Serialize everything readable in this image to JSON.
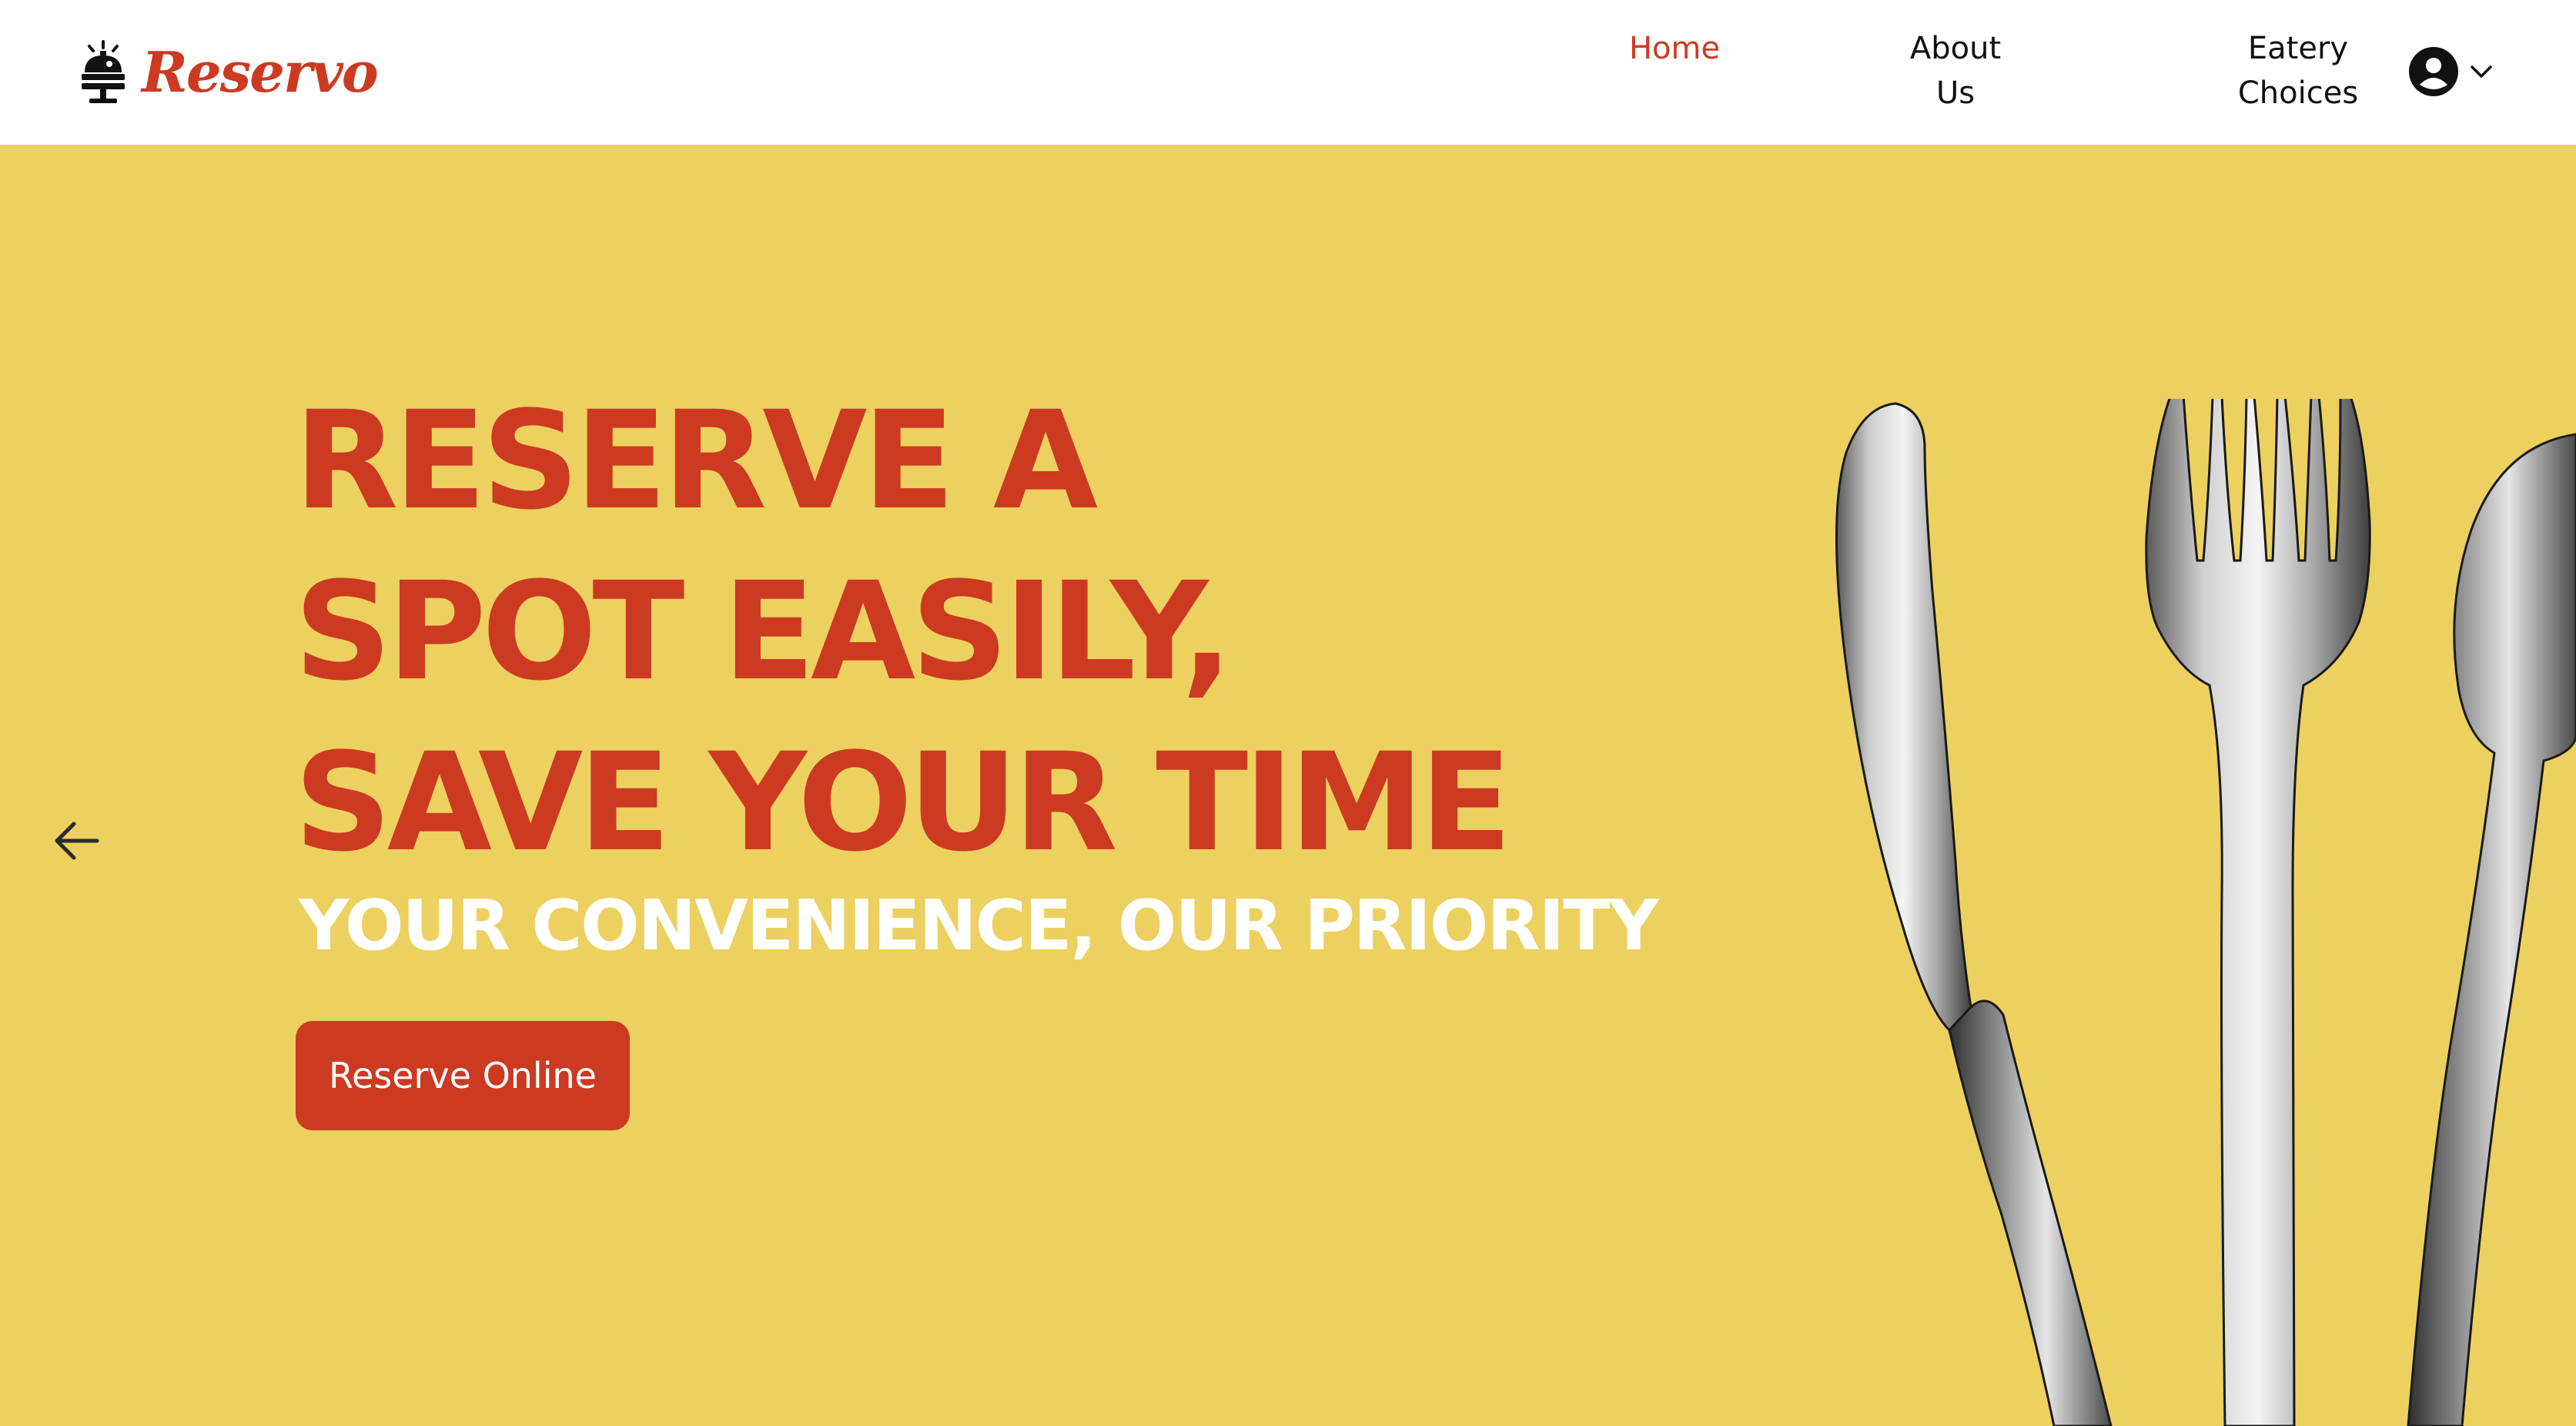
{
  "brand": {
    "name": "Reservo",
    "logo_icon": "service-bell-icon"
  },
  "nav": {
    "home": "Home",
    "about_line1": "About",
    "about_line2": "Us",
    "eatery_line1": "Eatery",
    "eatery_line2": "Choices",
    "account_icon": "user-circle-icon",
    "account_menu_icon": "chevron-down-icon"
  },
  "hero": {
    "headline_line1": "RESERVE A",
    "headline_line2": "SPOT EASILY,",
    "headline_line3": "SAVE YOUR TIME",
    "subheadline": "YOUR CONVENIENCE, OUR PRIORITY",
    "cta_label": "Reserve Online",
    "prev_icon": "arrow-left-icon",
    "image_alt": "cutlery-image"
  },
  "colors": {
    "brand_red": "#cc3a22",
    "hero_yellow": "#ecd161",
    "text_dark": "#111111",
    "white": "#ffffff"
  }
}
